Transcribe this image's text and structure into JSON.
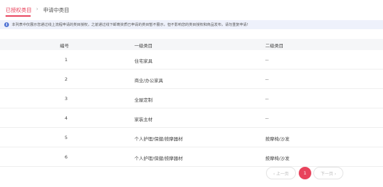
{
  "tabs": [
    {
      "label": "已授权类目",
      "active": true
    },
    {
      "label": "申请中类目",
      "active": false
    }
  ],
  "tab_separator": "›",
  "notice": {
    "icon": "info-icon",
    "text": "本列表中仅展示您通过线上流程申请的类目授权，之前通过线下邮寄资质已申请的类目暂不展示，但不影响您的类目授权和商品发布，请勿重复申请!"
  },
  "table": {
    "headers": [
      "编号",
      "一级类目",
      "二级类目"
    ],
    "rows": [
      {
        "num": "1",
        "level1": "住宅家具",
        "level2": "--"
      },
      {
        "num": "2",
        "level1": "商业/办公家具",
        "level2": "--"
      },
      {
        "num": "3",
        "level1": "全屋定制",
        "level2": "--"
      },
      {
        "num": "4",
        "level1": "家装主材",
        "level2": "--"
      },
      {
        "num": "5",
        "level1": "个人护理/保健/按摩器材",
        "level2": "按摩椅/沙发"
      },
      {
        "num": "6",
        "level1": "个人护理/保健/按摩器材",
        "level2": "按摩椅/沙发"
      }
    ]
  },
  "pagination": {
    "prev_label": "‹ 上一页",
    "current_page": "1",
    "next_label": "下一页 ›"
  },
  "colors": {
    "accent": "#e8435c",
    "notice_bg": "#eef1fb",
    "info_icon": "#5a7bd6"
  }
}
